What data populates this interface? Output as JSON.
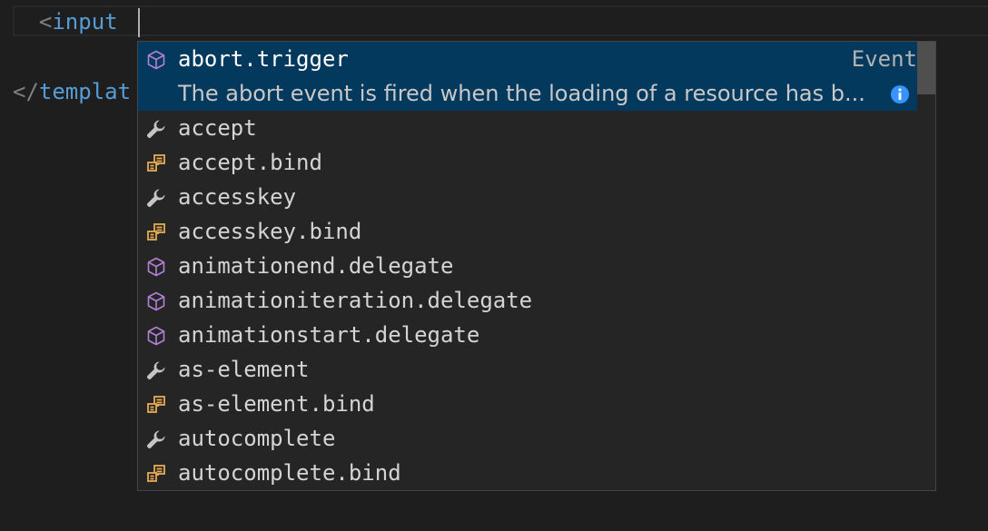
{
  "editor": {
    "line1": {
      "open_bracket": "<",
      "tag": "input"
    },
    "line3": {
      "open_bracket": "</",
      "tag": "templat"
    }
  },
  "suggest": {
    "selected": {
      "label": "abort.trigger",
      "type": "Event",
      "detail": "The abort event is fired when the loading of a resource has b...",
      "icon": "event-cube-icon"
    },
    "items": [
      {
        "label": "accept",
        "icon": "wrench-icon"
      },
      {
        "label": "accept.bind",
        "icon": "binding-icon"
      },
      {
        "label": "accesskey",
        "icon": "wrench-icon"
      },
      {
        "label": "accesskey.bind",
        "icon": "binding-icon"
      },
      {
        "label": "animationend.delegate",
        "icon": "event-cube-icon"
      },
      {
        "label": "animationiteration.delegate",
        "icon": "event-cube-icon"
      },
      {
        "label": "animationstart.delegate",
        "icon": "event-cube-icon"
      },
      {
        "label": "as-element",
        "icon": "wrench-icon"
      },
      {
        "label": "as-element.bind",
        "icon": "binding-icon"
      },
      {
        "label": "autocomplete",
        "icon": "wrench-icon"
      },
      {
        "label": "autocomplete.bind",
        "icon": "binding-icon"
      }
    ],
    "scroll_fraction": 0.0
  },
  "colors": {
    "background": "#1e1e1e",
    "suggest_background": "#252526",
    "selected_row": "#04395e",
    "tag": "#569cd6",
    "event_icon": "#b180d7",
    "binding_icon": "#e8ab53",
    "property_icon": "#c5c5c5",
    "info_icon": "#3794ff"
  }
}
